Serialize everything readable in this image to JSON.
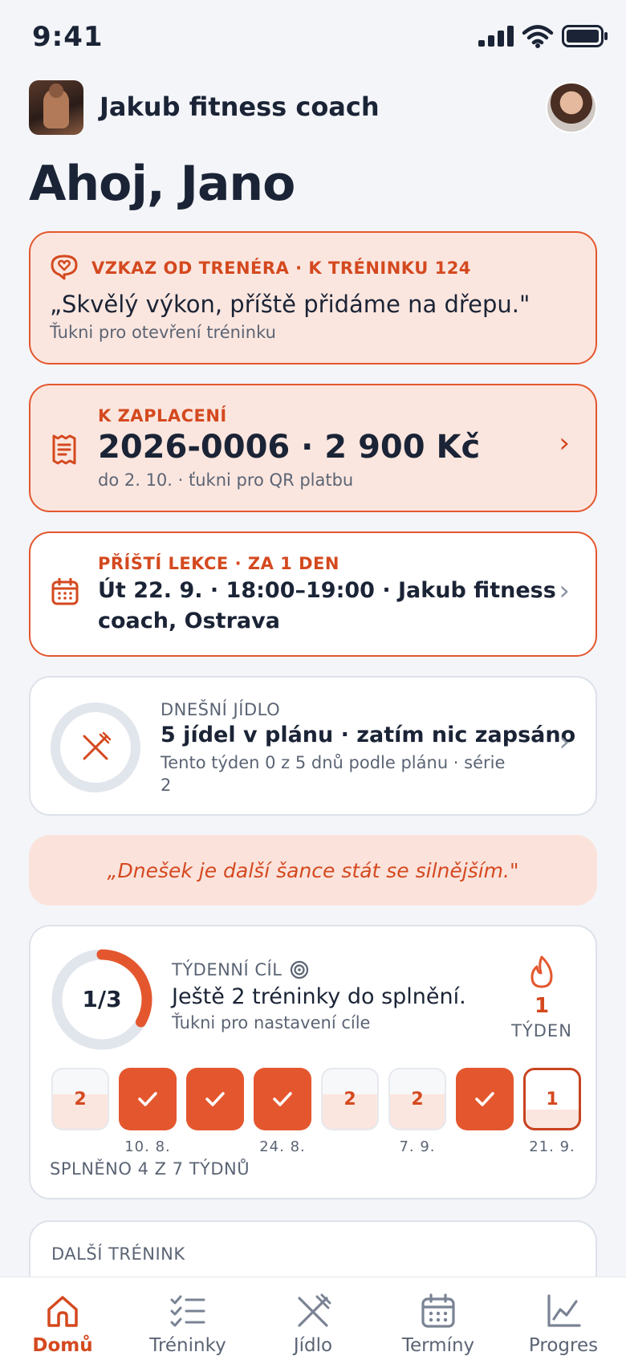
{
  "status_bar": {
    "time": "9:41"
  },
  "header": {
    "coach_name": "Jakub fitness coach"
  },
  "greeting": "Ahoj, Jano",
  "message_card": {
    "kicker": "VZKAZ OD TRENÉRA · K TRÉNINKU 124",
    "quote": "„Skvělý výkon, příště přidáme na dřepu.\"",
    "hint": "Ťukni pro otevření tréninku"
  },
  "payment_card": {
    "kicker": "K ZAPLACENÍ",
    "amount": "2026-0006 · 2 900 Kč",
    "hint": "do 2. 10. · ťukni pro QR platbu"
  },
  "lesson_card": {
    "kicker": "PŘÍŠTÍ LEKCE · ZA 1 DEN",
    "line1": "Út 22. 9. · 18:00–19:00 · Jakub fitness",
    "line2": "coach, Ostrava"
  },
  "meal_card": {
    "kicker": "DNEŠNÍ JÍDLO",
    "title": "5 jídel v plánu · zatím nic zapsáno",
    "line1": "Tento týden 0 z 5 dnů podle plánu · série",
    "line2": "2",
    "progress": 0
  },
  "motivation": "„Dnešek je další šance stát se silnějším.\"",
  "weekly_goal": {
    "ring_label": "1/3",
    "progress": 0.333,
    "kicker": "TÝDENNÍ CÍL",
    "text": "Ještě 2 tréninky do splnění.",
    "hint": "Ťukni pro nastavení cíle",
    "streak_value": "1",
    "streak_label": "TÝDEN",
    "weeks": [
      {
        "state": "partial",
        "count": "2",
        "label": ""
      },
      {
        "state": "done",
        "count": "",
        "label": "10. 8."
      },
      {
        "state": "done",
        "count": "",
        "label": ""
      },
      {
        "state": "done",
        "count": "",
        "label": "24. 8."
      },
      {
        "state": "partial",
        "count": "2",
        "label": ""
      },
      {
        "state": "partial",
        "count": "2",
        "label": "7. 9."
      },
      {
        "state": "done",
        "count": "",
        "label": ""
      },
      {
        "state": "current",
        "count": "1",
        "label": "21. 9."
      }
    ],
    "summary": "SPLNĚNO 4 Z 7 TÝDNŮ"
  },
  "next_training": {
    "kicker": "DALŠÍ TRÉNINK"
  },
  "tabs": [
    {
      "label": "Domů",
      "icon": "home-icon",
      "active": true
    },
    {
      "label": "Tréninky",
      "icon": "checklist-icon",
      "active": false
    },
    {
      "label": "Jídlo",
      "icon": "fork-knife-icon",
      "active": false
    },
    {
      "label": "Termíny",
      "icon": "calendar-icon",
      "active": false
    },
    {
      "label": "Progres",
      "icon": "chart-icon",
      "active": false
    }
  ],
  "colors": {
    "accent": "#E4572E",
    "accent_soft": "#FBE6DF",
    "text": "#1B2436",
    "muted": "#5B6474",
    "background": "#F3F5F9"
  }
}
